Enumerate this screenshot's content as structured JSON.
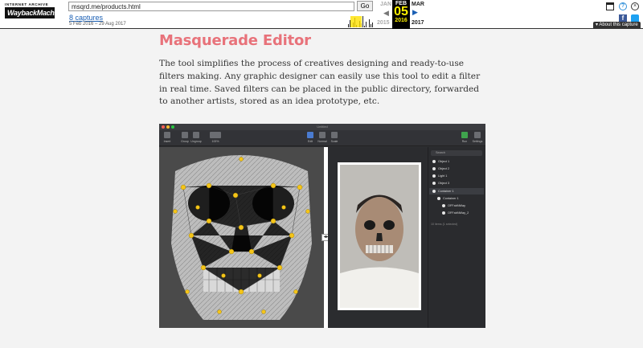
{
  "wayback": {
    "logo_top": "INTERNET ARCHIVE",
    "logo_main": "WaybackMachine",
    "url": "msqrd.me/products.html",
    "go_label": "Go",
    "captures_link": "8 captures",
    "date_range": "5 Feb 2016 – 29 Aug 2017",
    "prev_month": "JAN",
    "current_month": "FEB",
    "current_day": "05",
    "current_year": "2016",
    "next_month": "MAR",
    "prev_year": "2015",
    "next_year": "2017",
    "help_glyph": "?",
    "close_glyph": "×",
    "facebook_glyph": "f",
    "about_label": "▾ About this capture",
    "icons": [
      "window-icon",
      "help-icon",
      "close-icon",
      "facebook-icon",
      "twitter-icon"
    ]
  },
  "content": {
    "title": "Masquerade Editor",
    "intro": "The tool simplifies the process of creatives designing and ready-to-use filters making. Any graphic designer can easily use this tool to edit a filter in real time. Saved filters can be placed in the public directory, forwarded to another artists, stored as an idea prototype, etc."
  },
  "app": {
    "window_title": "Untitled",
    "toolbar": {
      "insert": "Insert",
      "group": "Group",
      "ungroup": "Ungroup",
      "zoom": "100%",
      "edit": "Edit",
      "normal": "Normal",
      "scale": "Scale",
      "run": "Run",
      "settings": "Settings"
    },
    "panel": {
      "search_placeholder": "Search",
      "items": [
        {
          "label": "Object 1",
          "indent": 0
        },
        {
          "label": "Object 2",
          "indent": 0
        },
        {
          "label": "Light 1",
          "indent": 0
        },
        {
          "label": "Object 3",
          "indent": 0
        },
        {
          "label": "Container 1",
          "indent": 0,
          "selected": true
        },
        {
          "label": "Container 1",
          "indent": 1
        },
        {
          "label": "OFFabNWay",
          "indent": 2
        },
        {
          "label": "OFFabNWay_2",
          "indent": 2
        }
      ],
      "status": "10 items (1 selected)"
    },
    "handle_glyph": "◂▸"
  },
  "colors": {
    "title": "#e8727a",
    "page_background": "#f3f3f3",
    "app_dark": "#2d2e31",
    "landmark_dot": "#f5c518",
    "link": "#1a5fb4"
  }
}
